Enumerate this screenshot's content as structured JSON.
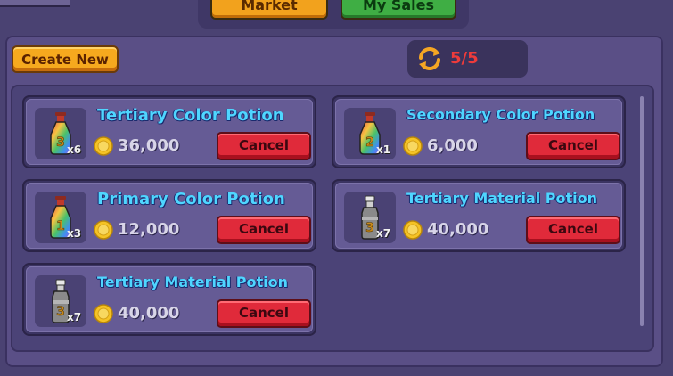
{
  "tabs": [
    {
      "label": "Market"
    },
    {
      "label": "My Sales"
    }
  ],
  "create_button": "Create New",
  "slots": {
    "count": "5/5",
    "icon": "refresh-icon"
  },
  "listings": [
    {
      "title": "Tertiary Color Potion",
      "qty": "x6",
      "price": "36,000",
      "cancel": "Cancel",
      "potion": "rainbow",
      "number": "3"
    },
    {
      "title": "Secondary Color Potion",
      "qty": "x1",
      "price": "6,000",
      "cancel": "Cancel",
      "potion": "rainbow",
      "number": "2"
    },
    {
      "title": "Primary Color Potion",
      "qty": "x3",
      "price": "12,000",
      "cancel": "Cancel",
      "potion": "rainbow",
      "number": "1"
    },
    {
      "title": "Tertiary Material Potion",
      "qty": "x7",
      "price": "40,000",
      "cancel": "Cancel",
      "potion": "material",
      "number": "3"
    },
    {
      "title": "Tertiary Material Potion",
      "qty": "x7",
      "price": "40,000",
      "cancel": "Cancel",
      "potion": "material",
      "number": "3"
    }
  ],
  "colors": {
    "title": "#4fd6ff",
    "cancel": "#e02a3a",
    "create": "#f6a91e",
    "slots_count": "#ee3b3b"
  }
}
